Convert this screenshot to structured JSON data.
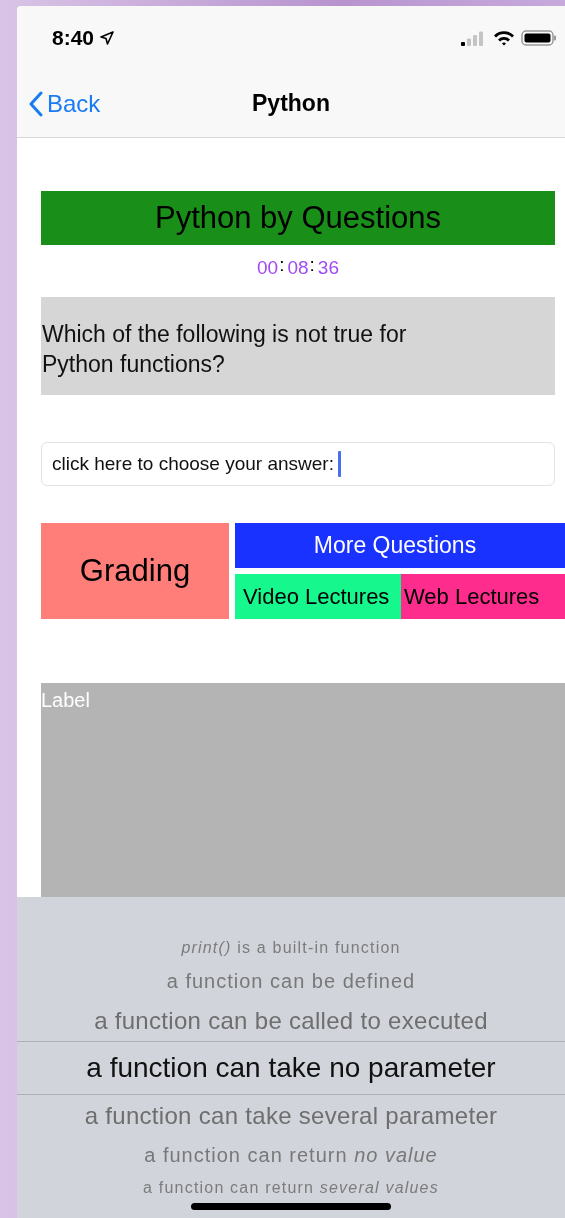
{
  "status_bar": {
    "time": "8:40",
    "location_on": true
  },
  "nav_bar": {
    "back_label": "Back",
    "title": "Python"
  },
  "quiz_title": "Python by Questions",
  "timer": [
    {
      "kind": "digits",
      "text": "00"
    },
    {
      "kind": "separator",
      "text": ":"
    },
    {
      "kind": "digits",
      "text": "08"
    },
    {
      "kind": "separator",
      "text": ":"
    },
    {
      "kind": "digits",
      "text": "36"
    }
  ],
  "question": "Which of the following is not true for Python functions?",
  "answer_field": {
    "value": "click here to choose your answer:",
    "focused": true
  },
  "buttons": {
    "grading": "Grading",
    "more_questions": "More Questions",
    "video_lectures": "Video Lectures",
    "web_lectures": "Web Lectures"
  },
  "result_label": "Label",
  "picker": [
    {
      "label": "*print()* is a built-in function",
      "selected": false
    },
    {
      "label": "a function can be defined",
      "selected": false
    },
    {
      "label": "a function can be called to executed",
      "selected": false
    },
    {
      "label": "a function can take no parameter",
      "selected": true
    },
    {
      "label": "a function can take several parameter",
      "selected": false
    },
    {
      "label": "a function can return *no value*",
      "selected": false
    },
    {
      "label": "a function can return *several values*",
      "selected": false
    }
  ]
}
